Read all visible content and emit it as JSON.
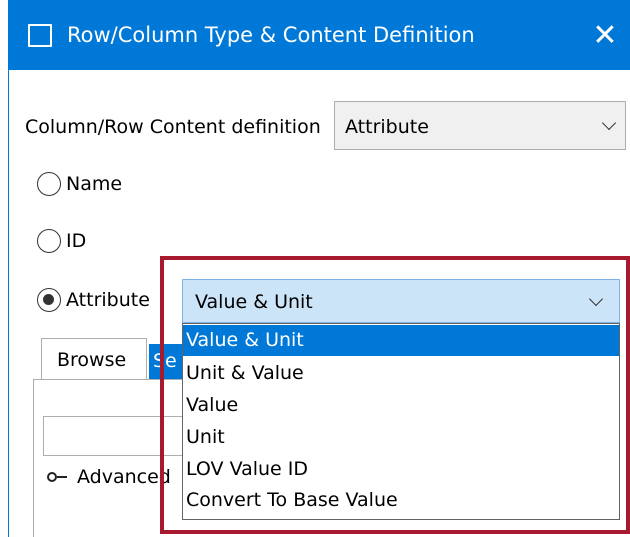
{
  "window": {
    "title": "Row/Column Type & Content Definition",
    "close_glyph": "✕",
    "accent_color": "#0078d7"
  },
  "content_definition": {
    "label": "Column/Row Content definition",
    "selected_value": "Attribute"
  },
  "radios": [
    {
      "label": "Name",
      "checked": false
    },
    {
      "label": "ID",
      "checked": false
    },
    {
      "label": "Attribute",
      "checked": true
    }
  ],
  "attribute_combo": {
    "selected_value": "Value & Unit",
    "options": [
      "Value & Unit",
      "Unit & Value",
      "Value",
      "Unit",
      "LOV Value ID",
      "Convert To Base Value"
    ],
    "highlighted_index": 0
  },
  "tabs": {
    "browse_label": "Browse",
    "second_label_visible": "Se"
  },
  "advanced": {
    "label": "Advanced",
    "icon": "key-icon"
  },
  "annotation": {
    "highlight_color": "#a6192e"
  }
}
